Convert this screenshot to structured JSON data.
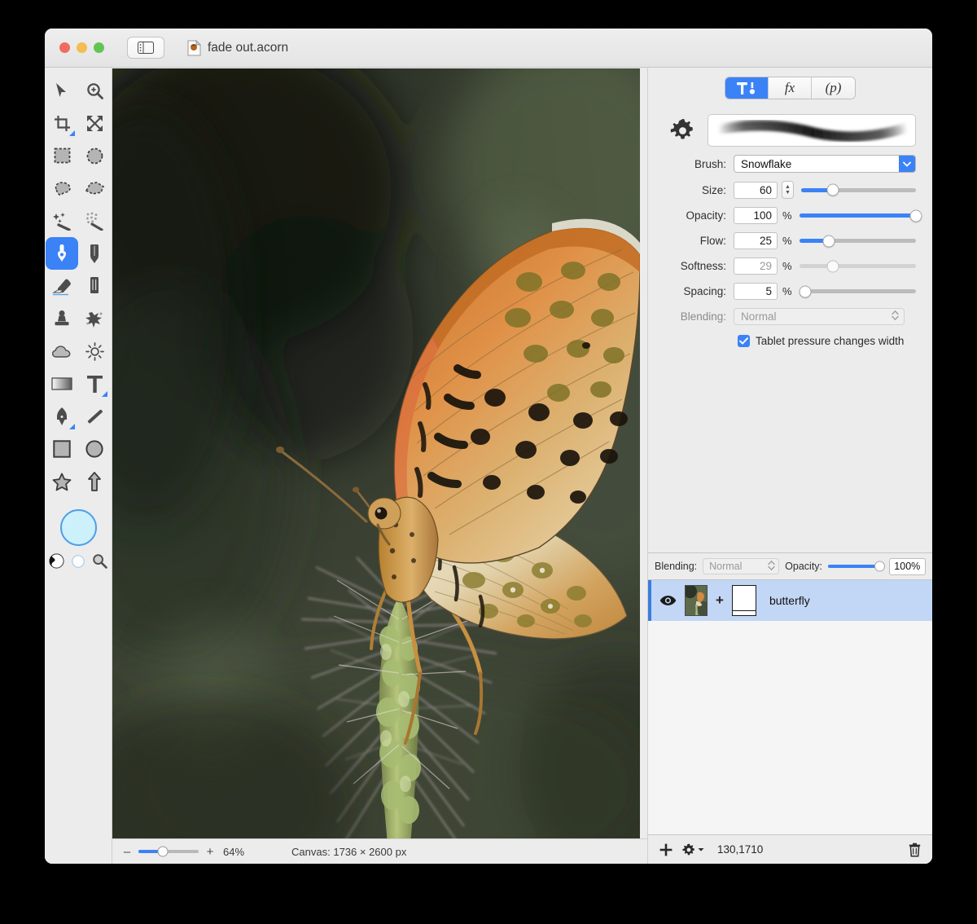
{
  "window": {
    "title": "fade out.acorn",
    "traffic_lights": [
      "close",
      "minimize",
      "zoom"
    ]
  },
  "toolbox": {
    "tools": [
      {
        "name": "move-tool",
        "icon": "arrow-cursor-icon",
        "active": false,
        "badge": false
      },
      {
        "name": "zoom-tool",
        "icon": "magnifier-plus-icon",
        "active": false,
        "badge": false
      },
      {
        "name": "crop-tool",
        "icon": "crop-icon",
        "active": false,
        "badge": true
      },
      {
        "name": "transform-tool",
        "icon": "four-arrows-icon",
        "active": false,
        "badge": false
      },
      {
        "name": "rectangle-select-tool",
        "icon": "dashed-rect-icon",
        "active": false,
        "badge": false
      },
      {
        "name": "ellipse-select-tool",
        "icon": "dashed-circle-icon",
        "active": false,
        "badge": false
      },
      {
        "name": "lasso-tool",
        "icon": "lasso-icon",
        "active": false,
        "badge": false
      },
      {
        "name": "polygon-lasso-tool",
        "icon": "polygon-lasso-icon",
        "active": false,
        "badge": false
      },
      {
        "name": "magic-wand-tool",
        "icon": "magic-wand-icon",
        "active": false,
        "badge": false
      },
      {
        "name": "selection-wand-tool",
        "icon": "halftone-wand-icon",
        "active": false,
        "badge": false
      },
      {
        "name": "brush-tool",
        "icon": "paintbrush-icon",
        "active": true,
        "badge": false
      },
      {
        "name": "pencil-tool",
        "icon": "pencil-icon",
        "active": false,
        "badge": false
      },
      {
        "name": "eraser-tool",
        "icon": "eraser-icon",
        "active": false,
        "badge": false
      },
      {
        "name": "marker-tool",
        "icon": "marker-icon",
        "active": false,
        "badge": false
      },
      {
        "name": "clone-stamp-tool",
        "icon": "stamp-icon",
        "active": false,
        "badge": false
      },
      {
        "name": "smudge-tool",
        "icon": "splatter-icon",
        "active": false,
        "badge": false
      },
      {
        "name": "blur-tool",
        "icon": "cloud-icon",
        "active": false,
        "badge": false
      },
      {
        "name": "dodge-tool",
        "icon": "sun-icon",
        "active": false,
        "badge": false
      },
      {
        "name": "gradient-tool",
        "icon": "gradient-icon",
        "active": false,
        "badge": false
      },
      {
        "name": "text-tool",
        "icon": "text-t-icon",
        "active": false,
        "badge": true
      },
      {
        "name": "pen-tool",
        "icon": "fountain-pen-icon",
        "active": false,
        "badge": true
      },
      {
        "name": "line-tool",
        "icon": "diagonal-line-icon",
        "active": false,
        "badge": false
      },
      {
        "name": "rectangle-shape-tool",
        "icon": "square-icon",
        "active": false,
        "badge": false
      },
      {
        "name": "ellipse-shape-tool",
        "icon": "circle-icon",
        "active": false,
        "badge": false
      },
      {
        "name": "star-shape-tool",
        "icon": "star-icon",
        "active": false,
        "badge": false
      },
      {
        "name": "arrow-shape-tool",
        "icon": "up-arrow-icon",
        "active": false,
        "badge": false
      }
    ],
    "foreground_color": "#cdf1fb",
    "mini_controls": [
      {
        "name": "black-white-swatch",
        "icon": "half-circle-icon"
      },
      {
        "name": "reset-colors-swatch",
        "icon": "empty-circle-icon"
      },
      {
        "name": "color-picker",
        "icon": "magnifier-icon"
      }
    ]
  },
  "inspector": {
    "segments": [
      {
        "label": "",
        "icon": "tools-hammer-icon",
        "selected": true,
        "name": "tab-tools"
      },
      {
        "label": "fx",
        "icon": "fx-icon",
        "selected": false,
        "name": "tab-filters"
      },
      {
        "label": "(p)",
        "icon": "palette-p-icon",
        "selected": false,
        "name": "tab-palette"
      }
    ],
    "gear_icon": "gear-icon",
    "brush_preview_alt": "brush-stroke-preview",
    "brush": {
      "label": "Brush:",
      "value": "Snowflake"
    },
    "size": {
      "label": "Size:",
      "value": "60",
      "unit": "",
      "slider_pct": 28,
      "disabled": false
    },
    "opacity": {
      "label": "Opacity:",
      "value": "100",
      "unit": "%",
      "slider_pct": 100,
      "disabled": false
    },
    "flow": {
      "label": "Flow:",
      "value": "25",
      "unit": "%",
      "slider_pct": 25,
      "disabled": false
    },
    "softness": {
      "label": "Softness:",
      "value": "29",
      "unit": "%",
      "slider_pct": 29,
      "disabled": true
    },
    "spacing": {
      "label": "Spacing:",
      "value": "5",
      "unit": "%",
      "slider_pct": 5,
      "disabled": false
    },
    "blending": {
      "label": "Blending:",
      "value": "Normal",
      "disabled": true
    },
    "tablet_pressure": {
      "label": "Tablet pressure changes width",
      "checked": true
    }
  },
  "layers": {
    "blending_label": "Blending:",
    "blending_value": "Normal",
    "opacity_label": "Opacity:",
    "opacity_value": "100%",
    "opacity_pct": 100,
    "rows": [
      {
        "name": "butterfly",
        "visible": true,
        "selected": true,
        "has_mask": true
      }
    ],
    "footer": {
      "add_icon": "plus-icon",
      "settings_icon": "gear-dropdown-icon",
      "coordinates": "130,1710",
      "delete_icon": "trash-icon"
    }
  },
  "statusbar": {
    "zoom_minus": "–",
    "zoom_plus": "+",
    "zoom_level": "64%",
    "zoom_pct": 40,
    "canvas_size": "Canvas: 1736 × 2600 px"
  },
  "colors": {
    "accent": "#3b82f6",
    "window_bg": "#ececec",
    "selection": "#c2d6f5",
    "desktop": "#000000"
  }
}
